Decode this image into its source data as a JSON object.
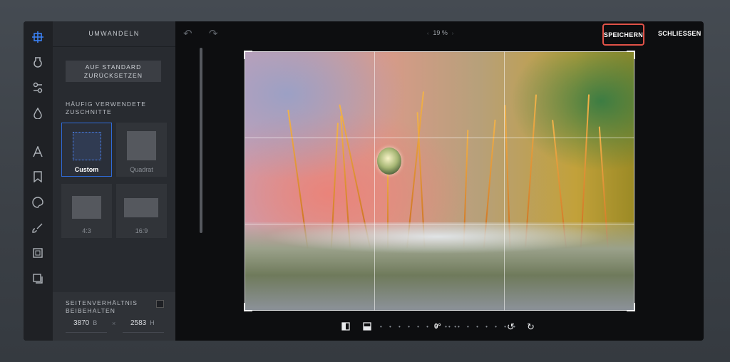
{
  "panel": {
    "title": "UMWANDELN",
    "reset_button_line1": "AUF STANDARD",
    "reset_button_line2": "ZURÜCKSETZEN",
    "frequent_crops_line1": "HÄUFIG VERWENDETE",
    "frequent_crops_line2": "ZUSCHNITTE",
    "crops": [
      {
        "label": "Custom",
        "selected": true
      },
      {
        "label": "Quadrat",
        "selected": false
      },
      {
        "label": "4:3",
        "selected": false
      },
      {
        "label": "16:9",
        "selected": false
      }
    ],
    "aspect_label_line1": "SEITENVERHÄLTNIS",
    "aspect_label_line2": "BEIBEHALTEN",
    "aspect_checked": false,
    "width_value": "3870",
    "width_unit": "B",
    "times": "×",
    "height_value": "2583",
    "height_unit": "H"
  },
  "toolbar": {
    "zoom": "19 %",
    "save_label": "SPEICHERN",
    "close_label": "SCHLIESSEN"
  },
  "rotation": {
    "angle": "0°"
  },
  "icons": {
    "sidebar": [
      "transform-icon",
      "filter-icon",
      "adjust-icon",
      "drop-icon",
      "text-icon",
      "bookmark-icon",
      "palette-icon",
      "brush-icon",
      "frame-icon",
      "shadow-icon"
    ]
  },
  "colors": {
    "accent": "#2f6bd8",
    "highlight": "#e05248"
  }
}
